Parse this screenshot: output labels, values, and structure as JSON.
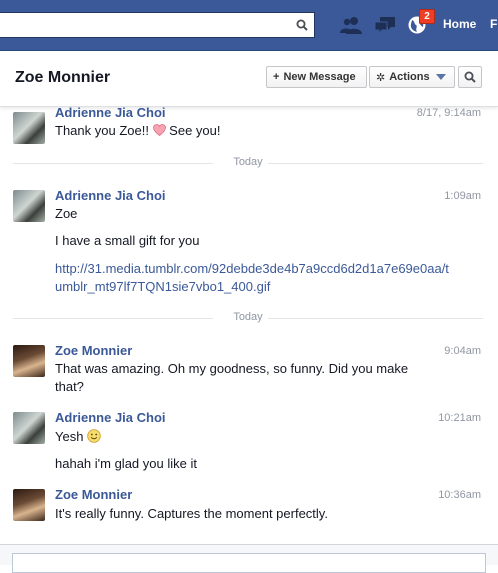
{
  "topbar": {
    "search": {
      "value": "",
      "placeholder": ""
    },
    "icons": {
      "search": "search-icon",
      "friends": "friends-icon",
      "messages": "messages-icon",
      "notifications": "globe-notifications-icon"
    },
    "notifications_count": "2",
    "home_label": "Home",
    "find_friends_label": "Find Friends",
    "colors": {
      "bar": "#3b5998",
      "badge": "#f03d25"
    }
  },
  "conversation": {
    "title": "Zoe Monnier",
    "new_message_label": "New Message",
    "actions_label": "Actions",
    "icons": {
      "new_message": "plus-icon",
      "actions": "gear-icon",
      "actions_caret": "caret-down-icon",
      "search": "search-icon"
    }
  },
  "thread": {
    "messages": [
      {
        "sender": "Adrienne Jia Choi",
        "time": "8/17, 9:14am",
        "lines": [
          "Thank you Zoe!! ",
          " See you!"
        ],
        "emoji": "heart-icon"
      },
      {
        "divider": "Today"
      },
      {
        "sender": "Adrienne Jia Choi",
        "time": "1:09am",
        "lines": [
          "Zoe",
          "I have a small gift for you"
        ],
        "link": "http://31.media.tumblr.com/92debde3de4b7a9ccd6d2d1a7e69e0aa/tumblr_mt97lf7TQN1sie7vbo1_400.gif"
      },
      {
        "divider": "Today"
      },
      {
        "sender": "Zoe Monnier",
        "time": "9:04am",
        "lines": [
          "That was amazing. Oh my goodness, so funny. Did you make that?"
        ]
      },
      {
        "sender": "Adrienne Jia Choi",
        "time": "10:21am",
        "lines": [
          "Yesh ",
          "hahah i'm glad you like it"
        ],
        "emoji": "smile-icon"
      },
      {
        "sender": "Zoe Monnier",
        "time": "10:36am",
        "lines": [
          "It's really funny. Captures the moment perfectly."
        ]
      }
    ],
    "colors": {
      "sender": "#3b5998",
      "time": "#9197a3",
      "link": "#3b5998"
    }
  }
}
